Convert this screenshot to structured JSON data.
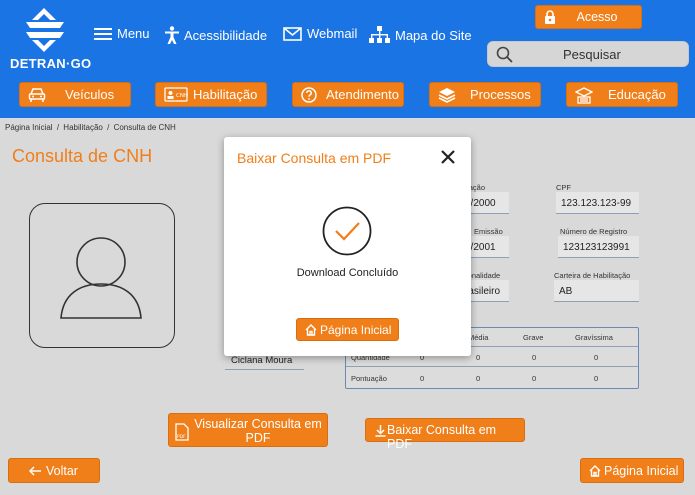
{
  "header": {
    "logo_text": "DETRAN·GO",
    "links": {
      "menu": "Menu",
      "acessibilidade": "Acessibilidade",
      "webmail": "Webmail",
      "mapa": "Mapa do Site"
    },
    "acesso_label": "Acesso",
    "search_placeholder": "Pesquisar"
  },
  "nav": {
    "veiculos": "Veículos",
    "habilitacao": "Habilitação",
    "atendimento": "Atendimento",
    "processos": "Processos",
    "educacao": "Educação"
  },
  "breadcrumb": [
    "Página Inicial",
    "/",
    "Habilitação",
    "/",
    "Consulta de CNH"
  ],
  "page_title": "Consulta de CNH",
  "profile": {
    "name": "Ciclana Moura"
  },
  "fields": {
    "habilitacao_label_partial": "itação",
    "habilitacao_value_partial": "2/2000",
    "cpf_label": "CPF",
    "cpf_value": "123.123.123-99",
    "emissao_label_partial": "Emissão",
    "emissao_value_partial": "6/2001",
    "registro_label": "Número de Registro",
    "registro_value": "123123123991",
    "nacionalidade_label_partial": "ionalidade",
    "nacionalidade_value_partial": "rasileiro",
    "categoria_label": "Carteira de Habilitação",
    "categoria_value": "AB"
  },
  "points_table": {
    "headers": [
      "Média",
      "Grave",
      "Gravíssima"
    ],
    "rows": [
      {
        "label": "Quantidade",
        "values": [
          "0",
          "0",
          "0",
          "0"
        ]
      },
      {
        "label": "Pontuação",
        "values": [
          "0",
          "0",
          "0",
          "0"
        ]
      }
    ]
  },
  "actions": {
    "visualizar": "Visualizar Consulta em PDF",
    "baixar": "Baixar Consulta em PDF",
    "voltar": "Voltar",
    "home": "Página Inicial"
  },
  "modal": {
    "title": "Baixar Consulta em PDF",
    "message": "Download Concluído",
    "button": "Página Inicial"
  },
  "colors": {
    "header_blue": "#1b74e4",
    "accent_orange": "#f07f1a",
    "background": "#d9d9d9"
  }
}
